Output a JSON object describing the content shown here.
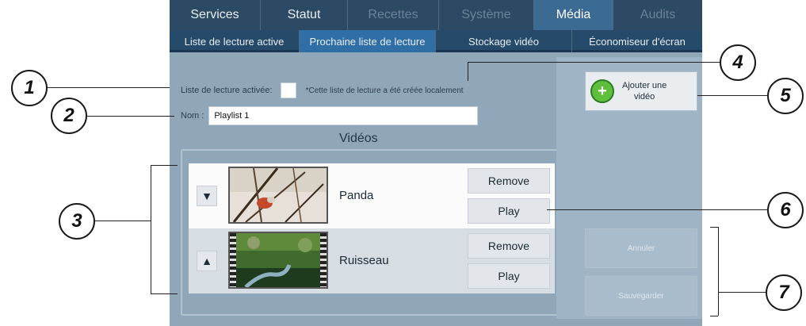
{
  "topnav": {
    "tabs": [
      {
        "label": "Services",
        "state": "normal"
      },
      {
        "label": "Statut",
        "state": "normal"
      },
      {
        "label": "Recettes",
        "state": "disabled"
      },
      {
        "label": "Système",
        "state": "disabled"
      },
      {
        "label": "Média",
        "state": "active"
      },
      {
        "label": "Audits",
        "state": "disabled"
      }
    ]
  },
  "subnav": {
    "tabs": [
      {
        "label": "Liste de lecture active",
        "state": "normal"
      },
      {
        "label": "Prochaine liste de lecture",
        "state": "active"
      },
      {
        "label": "Stockage vidéo",
        "state": "normal"
      },
      {
        "label": "Économiseur d'écran",
        "state": "normal"
      }
    ]
  },
  "form": {
    "active_label": "Liste de lecture activée:",
    "local_note": "*Cette liste de lecture a été créée localement",
    "name_label": "Nom :",
    "name_value": "Playlist 1"
  },
  "videos": {
    "title": "Vidéos",
    "items": [
      {
        "name": "Panda",
        "arrow": "▼",
        "remove_label": "Remove",
        "play_label": "Play",
        "thumb_colors": [
          "#3a2a1c",
          "#8c6a48",
          "#c4492a",
          "#e6e0d8"
        ]
      },
      {
        "name": "Ruisseau",
        "arrow": "▲",
        "remove_label": "Remove",
        "play_label": "Play",
        "thumb_colors": [
          "#1f3b1f",
          "#3f6b2c",
          "#8fa06a",
          "#7fa3b5"
        ]
      }
    ]
  },
  "side": {
    "add_label_line1": "Ajouter une",
    "add_label_line2": "vidéo",
    "cancel_label": "Annuler",
    "save_label": "Sauvegarder"
  },
  "callouts": [
    "1",
    "2",
    "3",
    "4",
    "5",
    "6",
    "7"
  ],
  "colors": {
    "nav_bg": "#2c4a63",
    "active_tab": "#3b6a93",
    "subnav_active": "#2f6fa6",
    "panel_bg": "#8fa7b9",
    "add_icon": "#5fbf3d"
  }
}
